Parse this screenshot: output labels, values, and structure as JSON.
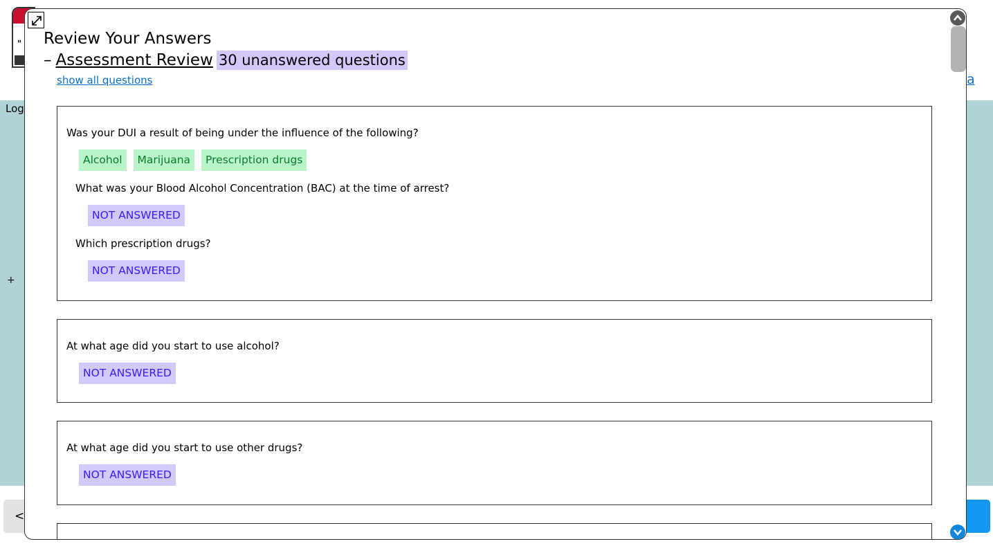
{
  "background": {
    "nav_prev_label": "<",
    "right_link_fragment": "a",
    "left_label_fragment": "Log",
    "plus_label": "+"
  },
  "modal": {
    "title": "Review Your Answers",
    "section_prefix": "–",
    "section_name": "Assessment Review",
    "unanswered_badge": "30 unanswered questions",
    "show_all_link": "show all questions",
    "answer_chip_color": "#b9f5c9",
    "not_answered_chip_color": "#d3c9fb"
  },
  "questions": [
    {
      "text": "Was your DUI a result of being under the influence of the following?",
      "answers": [
        "Alcohol",
        "Marijuana",
        "Prescription drugs"
      ],
      "followups": [
        {
          "text": "What was your Blood Alcohol Concentration (BAC) at the time of arrest?",
          "answer": "NOT ANSWERED"
        },
        {
          "text": "Which prescription drugs?",
          "answer": "NOT ANSWERED"
        }
      ]
    },
    {
      "text": "At what age did you start to use alcohol?",
      "answer": "NOT ANSWERED"
    },
    {
      "text": "At what age did you start to use other drugs?",
      "answer": "NOT ANSWERED"
    }
  ]
}
